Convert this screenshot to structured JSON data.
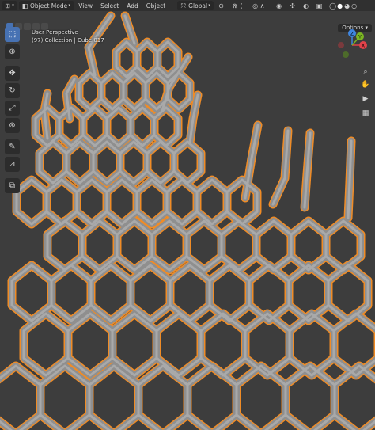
{
  "header": {
    "editor_type_icon": "editor-type-icon",
    "mode_label": "Object Mode",
    "menus": [
      "View",
      "Select",
      "Add",
      "Object"
    ],
    "transform_orientation": "Global"
  },
  "subheader": {
    "options_label": "Options"
  },
  "viewport": {
    "perspective_label": "User Perspective",
    "collection_label": "(97) Collection | Cube.017"
  },
  "gizmo": {
    "x_label": "X",
    "y_label": "Y",
    "z_label": "Z",
    "x_color": "#e2424a",
    "y_color": "#7bb523",
    "z_color": "#3f86e0"
  },
  "toolbar": {
    "tools": [
      "select-box-icon",
      "cursor-icon",
      "move-icon",
      "rotate-icon",
      "scale-icon",
      "transform-icon",
      "annotate-icon",
      "measure-icon",
      "add-cube-icon"
    ]
  },
  "colors": {
    "background": "#3d3d3d",
    "mesh_fill": "#9a9a9a",
    "selection_outline": "#f08c26",
    "active_tool": "#4772b3"
  }
}
